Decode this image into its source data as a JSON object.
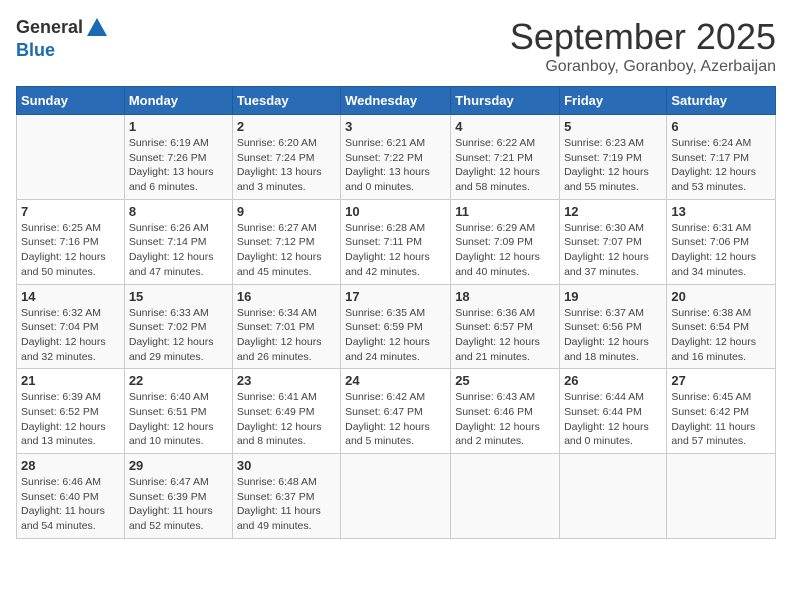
{
  "header": {
    "logo_line1": "General",
    "logo_line2": "Blue",
    "month_title": "September 2025",
    "subtitle": "Goranboy, Goranboy, Azerbaijan"
  },
  "days_of_week": [
    "Sunday",
    "Monday",
    "Tuesday",
    "Wednesday",
    "Thursday",
    "Friday",
    "Saturday"
  ],
  "weeks": [
    [
      {
        "day": "",
        "info": ""
      },
      {
        "day": "1",
        "info": "Sunrise: 6:19 AM\nSunset: 7:26 PM\nDaylight: 13 hours\nand 6 minutes."
      },
      {
        "day": "2",
        "info": "Sunrise: 6:20 AM\nSunset: 7:24 PM\nDaylight: 13 hours\nand 3 minutes."
      },
      {
        "day": "3",
        "info": "Sunrise: 6:21 AM\nSunset: 7:22 PM\nDaylight: 13 hours\nand 0 minutes."
      },
      {
        "day": "4",
        "info": "Sunrise: 6:22 AM\nSunset: 7:21 PM\nDaylight: 12 hours\nand 58 minutes."
      },
      {
        "day": "5",
        "info": "Sunrise: 6:23 AM\nSunset: 7:19 PM\nDaylight: 12 hours\nand 55 minutes."
      },
      {
        "day": "6",
        "info": "Sunrise: 6:24 AM\nSunset: 7:17 PM\nDaylight: 12 hours\nand 53 minutes."
      }
    ],
    [
      {
        "day": "7",
        "info": "Sunrise: 6:25 AM\nSunset: 7:16 PM\nDaylight: 12 hours\nand 50 minutes."
      },
      {
        "day": "8",
        "info": "Sunrise: 6:26 AM\nSunset: 7:14 PM\nDaylight: 12 hours\nand 47 minutes."
      },
      {
        "day": "9",
        "info": "Sunrise: 6:27 AM\nSunset: 7:12 PM\nDaylight: 12 hours\nand 45 minutes."
      },
      {
        "day": "10",
        "info": "Sunrise: 6:28 AM\nSunset: 7:11 PM\nDaylight: 12 hours\nand 42 minutes."
      },
      {
        "day": "11",
        "info": "Sunrise: 6:29 AM\nSunset: 7:09 PM\nDaylight: 12 hours\nand 40 minutes."
      },
      {
        "day": "12",
        "info": "Sunrise: 6:30 AM\nSunset: 7:07 PM\nDaylight: 12 hours\nand 37 minutes."
      },
      {
        "day": "13",
        "info": "Sunrise: 6:31 AM\nSunset: 7:06 PM\nDaylight: 12 hours\nand 34 minutes."
      }
    ],
    [
      {
        "day": "14",
        "info": "Sunrise: 6:32 AM\nSunset: 7:04 PM\nDaylight: 12 hours\nand 32 minutes."
      },
      {
        "day": "15",
        "info": "Sunrise: 6:33 AM\nSunset: 7:02 PM\nDaylight: 12 hours\nand 29 minutes."
      },
      {
        "day": "16",
        "info": "Sunrise: 6:34 AM\nSunset: 7:01 PM\nDaylight: 12 hours\nand 26 minutes."
      },
      {
        "day": "17",
        "info": "Sunrise: 6:35 AM\nSunset: 6:59 PM\nDaylight: 12 hours\nand 24 minutes."
      },
      {
        "day": "18",
        "info": "Sunrise: 6:36 AM\nSunset: 6:57 PM\nDaylight: 12 hours\nand 21 minutes."
      },
      {
        "day": "19",
        "info": "Sunrise: 6:37 AM\nSunset: 6:56 PM\nDaylight: 12 hours\nand 18 minutes."
      },
      {
        "day": "20",
        "info": "Sunrise: 6:38 AM\nSunset: 6:54 PM\nDaylight: 12 hours\nand 16 minutes."
      }
    ],
    [
      {
        "day": "21",
        "info": "Sunrise: 6:39 AM\nSunset: 6:52 PM\nDaylight: 12 hours\nand 13 minutes."
      },
      {
        "day": "22",
        "info": "Sunrise: 6:40 AM\nSunset: 6:51 PM\nDaylight: 12 hours\nand 10 minutes."
      },
      {
        "day": "23",
        "info": "Sunrise: 6:41 AM\nSunset: 6:49 PM\nDaylight: 12 hours\nand 8 minutes."
      },
      {
        "day": "24",
        "info": "Sunrise: 6:42 AM\nSunset: 6:47 PM\nDaylight: 12 hours\nand 5 minutes."
      },
      {
        "day": "25",
        "info": "Sunrise: 6:43 AM\nSunset: 6:46 PM\nDaylight: 12 hours\nand 2 minutes."
      },
      {
        "day": "26",
        "info": "Sunrise: 6:44 AM\nSunset: 6:44 PM\nDaylight: 12 hours\nand 0 minutes."
      },
      {
        "day": "27",
        "info": "Sunrise: 6:45 AM\nSunset: 6:42 PM\nDaylight: 11 hours\nand 57 minutes."
      }
    ],
    [
      {
        "day": "28",
        "info": "Sunrise: 6:46 AM\nSunset: 6:40 PM\nDaylight: 11 hours\nand 54 minutes."
      },
      {
        "day": "29",
        "info": "Sunrise: 6:47 AM\nSunset: 6:39 PM\nDaylight: 11 hours\nand 52 minutes."
      },
      {
        "day": "30",
        "info": "Sunrise: 6:48 AM\nSunset: 6:37 PM\nDaylight: 11 hours\nand 49 minutes."
      },
      {
        "day": "",
        "info": ""
      },
      {
        "day": "",
        "info": ""
      },
      {
        "day": "",
        "info": ""
      },
      {
        "day": "",
        "info": ""
      }
    ]
  ]
}
